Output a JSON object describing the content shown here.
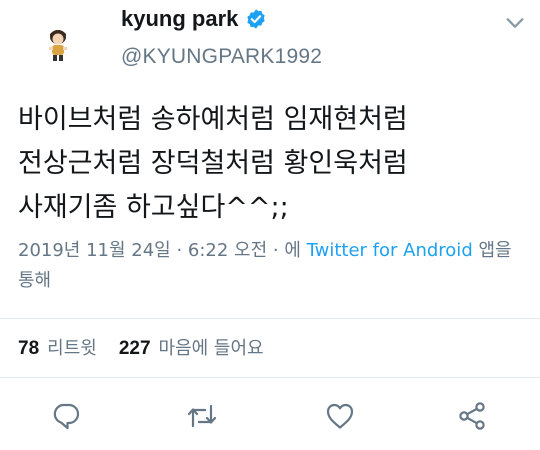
{
  "user": {
    "display_name": "kyung park",
    "handle": "@KYUNGPARK1992",
    "verified": true
  },
  "tweet": {
    "lines": [
      "바이브처럼 송하예처럼 임재현처럼",
      "전상근처럼 장덕철처럼 황인욱처럼",
      "사재기좀 하고싶다^^;;"
    ]
  },
  "meta": {
    "datetime": "2019년 11월 24일 · 6:22 오전 · 에 ",
    "source_link": "Twitter for Android",
    "source_suffix": " 앱을 통해"
  },
  "stats": {
    "retweets_count": "78",
    "retweets_label": "리트윗",
    "likes_count": "227",
    "likes_label": "마음에 들어요"
  },
  "icons": {
    "reply": "reply-icon",
    "retweet": "retweet-icon",
    "like": "heart-icon",
    "share": "share-icon",
    "more": "chevron-down-icon",
    "verified": "verified-badge-icon"
  },
  "colors": {
    "accent": "#1da1f2",
    "secondary_text": "#657786",
    "primary_text": "#14171a"
  }
}
